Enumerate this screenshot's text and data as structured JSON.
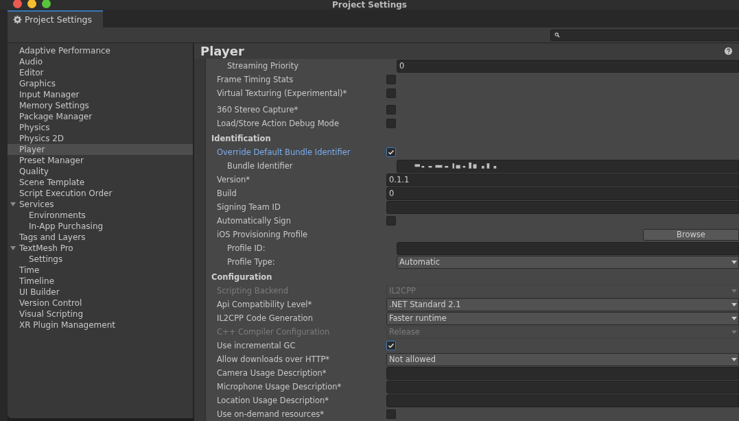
{
  "window": {
    "title": "Project Settings"
  },
  "tabs": [
    {
      "label": "Project Settings",
      "selected": true
    }
  ],
  "sidebar": {
    "items": [
      {
        "label": "Adaptive Performance",
        "selected": false
      },
      {
        "label": "Audio",
        "selected": false
      },
      {
        "label": "Editor",
        "selected": false
      },
      {
        "label": "Graphics",
        "selected": false
      },
      {
        "label": "Input Manager",
        "selected": false
      },
      {
        "label": "Memory Settings",
        "selected": false
      },
      {
        "label": "Package Manager",
        "selected": false
      },
      {
        "label": "Physics",
        "selected": false
      },
      {
        "label": "Physics 2D",
        "selected": false
      },
      {
        "label": "Player",
        "selected": true
      },
      {
        "label": "Preset Manager",
        "selected": false
      },
      {
        "label": "Quality",
        "selected": false
      },
      {
        "label": "Scene Template",
        "selected": false
      },
      {
        "label": "Script Execution Order",
        "selected": false
      },
      {
        "label": "Services",
        "selected": false,
        "expanded": true,
        "children": [
          {
            "label": "Environments",
            "selected": false
          },
          {
            "label": "In-App Purchasing",
            "selected": false
          }
        ]
      },
      {
        "label": "Tags and Layers",
        "selected": false
      },
      {
        "label": "TextMesh Pro",
        "selected": false,
        "expanded": true,
        "children": [
          {
            "label": "Settings",
            "selected": false
          }
        ]
      },
      {
        "label": "Time",
        "selected": false
      },
      {
        "label": "Timeline",
        "selected": false
      },
      {
        "label": "UI Builder",
        "selected": false
      },
      {
        "label": "Version Control",
        "selected": false
      },
      {
        "label": "Visual Scripting",
        "selected": false
      },
      {
        "label": "XR Plugin Management",
        "selected": false
      }
    ]
  },
  "panel": {
    "title": "Player",
    "sections": [
      {
        "rows": [
          {
            "kind": "group",
            "children": [
              {
                "kind": "text",
                "label": "Streaming Priority",
                "value": "0",
                "disabled": false,
                "highlighted": false
              }
            ]
          },
          {
            "kind": "checkbox",
            "label": "Frame Timing Stats",
            "checked": false,
            "disabled": false,
            "highlighted": false
          },
          {
            "kind": "checkbox",
            "label": "Virtual Texturing (Experimental)*",
            "checked": false,
            "disabled": false,
            "highlighted": false
          },
          {
            "kind": "space"
          },
          {
            "kind": "checkbox",
            "label": "360 Stereo Capture*",
            "checked": false,
            "disabled": false,
            "highlighted": false
          },
          {
            "kind": "checkbox",
            "label": "Load/Store Action Debug Mode",
            "checked": false,
            "disabled": false,
            "highlighted": false
          }
        ]
      },
      {
        "title": "Identification",
        "rows": [
          {
            "kind": "checkbox",
            "label": "Override Default Bundle Identifier",
            "checked": true,
            "disabled": false,
            "highlighted": true,
            "children": [
              {
                "kind": "obscured",
                "label": "Bundle Identifier",
                "disabled": false,
                "highlighted": false
              }
            ]
          },
          {
            "kind": "text",
            "label": "Version*",
            "value": "0.1.1",
            "disabled": false,
            "highlighted": false
          },
          {
            "kind": "text",
            "label": "Build",
            "value": "0",
            "disabled": false,
            "highlighted": false
          },
          {
            "kind": "text",
            "label": "Signing Team ID",
            "disabled": false,
            "highlighted": false
          },
          {
            "kind": "checkbox",
            "label": "Automatically Sign",
            "checked": false,
            "disabled": false,
            "highlighted": false
          },
          {
            "kind": "button",
            "label": "iOS Provisioning Profile",
            "button": "Browse",
            "disabled": false,
            "highlighted": false,
            "children": [
              {
                "kind": "text",
                "label": "Profile ID:",
                "disabled": false,
                "highlighted": false
              },
              {
                "kind": "dropdown",
                "label": "Profile Type:",
                "value": "Automatic",
                "disabled": false,
                "highlighted": false
              }
            ]
          }
        ]
      },
      {
        "title": "Configuration",
        "rows": [
          {
            "kind": "dropdown",
            "label": "Scripting Backend",
            "value": "IL2CPP",
            "disabled": true,
            "highlighted": false
          },
          {
            "kind": "dropdown",
            "label": "Api Compatibility Level*",
            "value": ".NET Standard 2.1",
            "disabled": false,
            "highlighted": false
          },
          {
            "kind": "dropdown",
            "label": "IL2CPP Code Generation",
            "value": "Faster runtime",
            "disabled": false,
            "highlighted": false
          },
          {
            "kind": "dropdown",
            "label": "C++ Compiler Configuration",
            "value": "Release",
            "disabled": true,
            "highlighted": false
          },
          {
            "kind": "checkbox",
            "label": "Use incremental GC",
            "checked": true,
            "disabled": false,
            "highlighted": false
          },
          {
            "kind": "dropdown",
            "label": "Allow downloads over HTTP*",
            "value": "Not allowed",
            "disabled": false,
            "highlighted": false
          },
          {
            "kind": "text",
            "label": "Camera Usage Description*",
            "disabled": false,
            "highlighted": false
          },
          {
            "kind": "text",
            "label": "Microphone Usage Description*",
            "disabled": false,
            "highlighted": false
          },
          {
            "kind": "text",
            "label": "Location Usage Description*",
            "disabled": false,
            "highlighted": false
          },
          {
            "kind": "checkbox",
            "label": "Use on-demand resources*",
            "checked": false,
            "disabled": false,
            "highlighted": false
          }
        ]
      }
    ]
  }
}
